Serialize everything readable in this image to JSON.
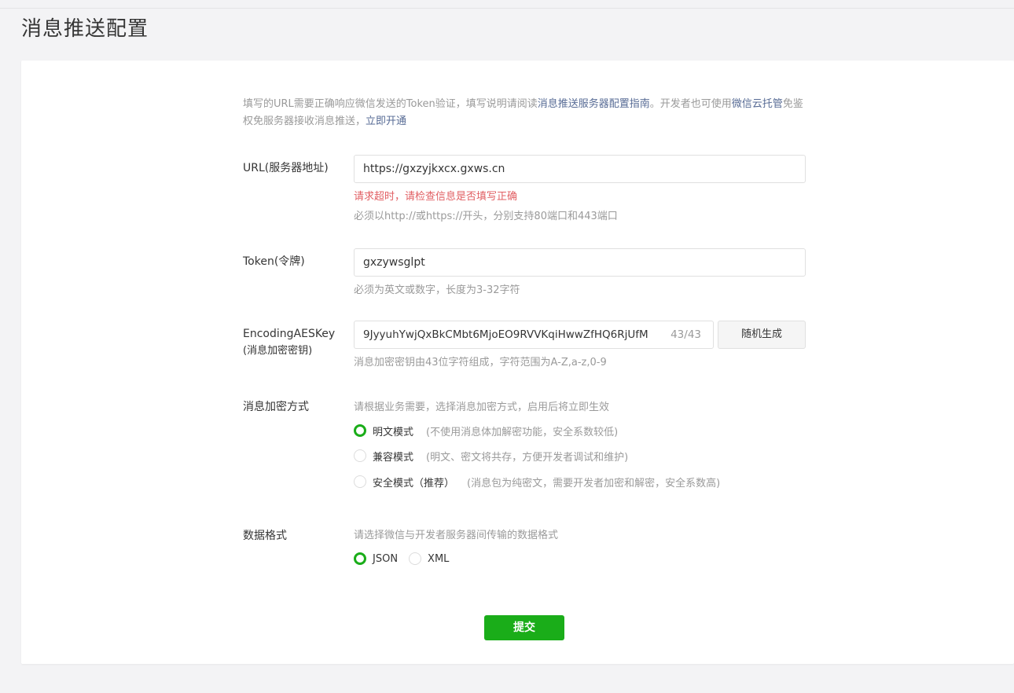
{
  "page": {
    "title": "消息推送配置"
  },
  "intro": {
    "part1": "填写的URL需要正确响应微信发送的Token验证，填写说明请阅读",
    "link1": "消息推送服务器配置指南",
    "part2": "。开发者也可使用",
    "link2": "微信云托管",
    "part3": "免鉴权免服务器接收消息推送，",
    "link3": "立即开通"
  },
  "url_field": {
    "label": "URL(服务器地址)",
    "value": "https://gxzyjkxcx.gxws.cn",
    "error": "请求超时，请检查信息是否填写正确",
    "hint": "必须以http://或https://开头，分别支持80端口和443端口"
  },
  "token_field": {
    "label": "Token(令牌)",
    "value": "gxzywsglpt",
    "hint": "必须为英文或数字，长度为3-32字符"
  },
  "aes_field": {
    "label_line1": "EncodingAESKey",
    "label_line2": "(消息加密密钥)",
    "value": "9JyyuhYwjQxBkCMbt6MjoEO9RVVKqiHwwZfHQ6RjUfM",
    "count": "43/43",
    "generate_button": "随机生成",
    "hint": "消息加密密钥由43位字符组成，字符范围为A-Z,a-z,0-9"
  },
  "encryption": {
    "label": "消息加密方式",
    "hint": "请根据业务需要，选择消息加密方式，启用后将立即生效",
    "options": [
      {
        "label": "明文模式",
        "desc": "(不使用消息体加解密功能，安全系数较低)",
        "selected": true
      },
      {
        "label": "兼容模式",
        "desc": "(明文、密文将共存，方便开发者调试和维护)",
        "selected": false
      },
      {
        "label": "安全模式（推荐）",
        "desc": "(消息包为纯密文，需要开发者加密和解密，安全系数高)",
        "selected": false
      }
    ]
  },
  "data_format": {
    "label": "数据格式",
    "hint": "请选择微信与开发者服务器间传输的数据格式",
    "options": [
      {
        "label": "JSON",
        "selected": true
      },
      {
        "label": "XML",
        "selected": false
      }
    ]
  },
  "submit_label": "提交",
  "colors": {
    "accent": "#1aad19",
    "link": "#576b95",
    "error": "#e15f63"
  }
}
